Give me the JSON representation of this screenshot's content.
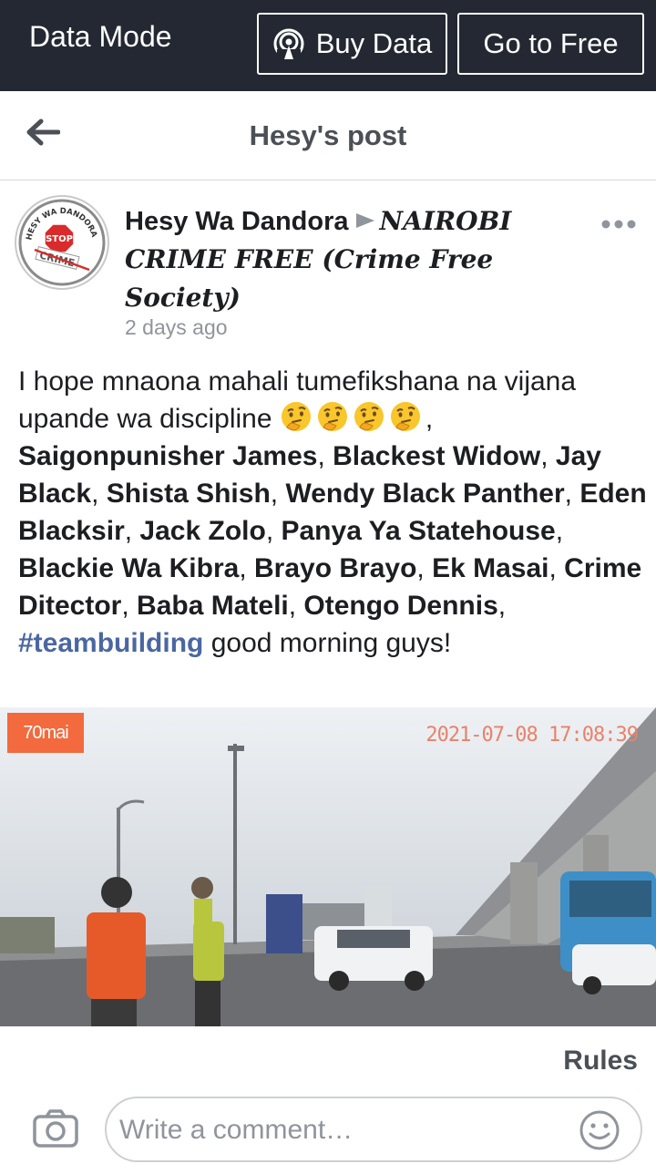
{
  "data_bar": {
    "label": "Data Mode",
    "buy_data": "Buy Data",
    "go_free": "Go to Free"
  },
  "header": {
    "title": "Hesy's post"
  },
  "post": {
    "author": "Hesy Wa Dandora",
    "group": "NAIROBI CRIME FREE (Crime Free Society)",
    "timestamp": "2 days ago",
    "avatar_text": {
      "top": "HESY WA DANDORA",
      "sign": "STOP",
      "bottom": "CRIME"
    },
    "text_intro": "I hope mnaona mahali tumefikshana na vijana upande wa discipline",
    "emoji": "thinking-face",
    "tags": [
      "Saigonpunisher James",
      "Blackest Widow",
      "Jay Black",
      "Shista Shish",
      "Wendy Black Panther",
      "Eden Blacksir",
      "Jack Zolo",
      "Panya Ya Statehouse",
      "Blackie Wa Kibra",
      "Brayo Brayo",
      "Ek Masai",
      "Crime Ditector",
      "Baba Mateli",
      "Otengo Dennis"
    ],
    "hashtag": "#teambuilding",
    "text_outro": "good morning guys!"
  },
  "video": {
    "brand": "70mai",
    "timestamp": "2021-07-08 17:08:39"
  },
  "footer": {
    "rules": "Rules",
    "comment_placeholder": "Write a comment…"
  },
  "colors": {
    "data_bar_bg": "#232832",
    "hashtag": "#4b67a1",
    "muted": "#90949c"
  }
}
